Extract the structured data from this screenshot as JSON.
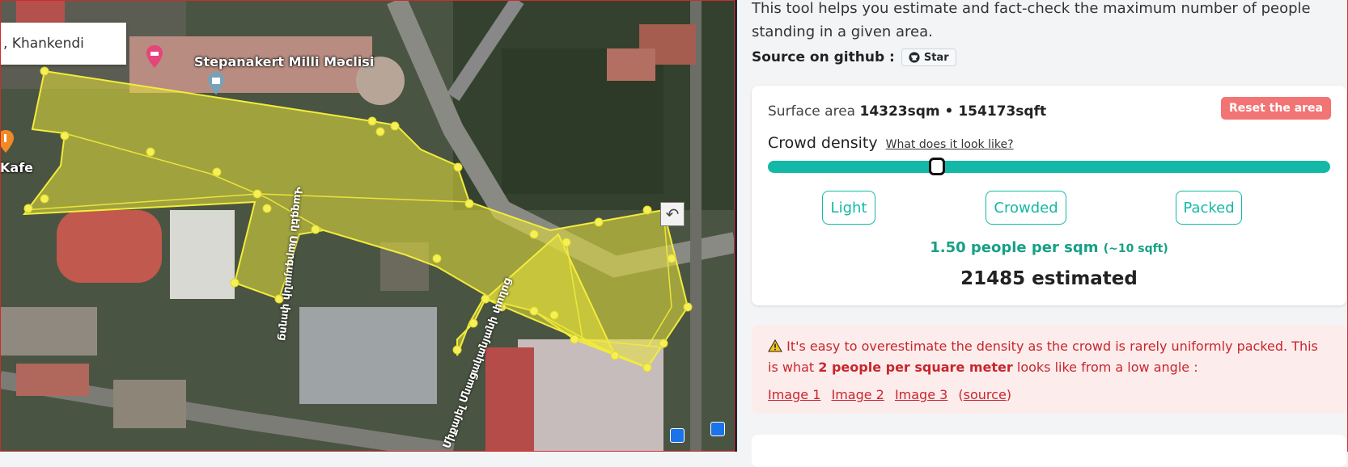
{
  "map": {
    "search_value": ", Khankendi",
    "places": [
      {
        "name": "Stepanakert Milli Məclisi"
      },
      {
        "name": "Kafe"
      }
    ],
    "streets": [
      "Կոմիտասի փողոց",
      "Վազգեն Սարգսյանի փողոց",
      "Միքայել Մնացականյանի փողոց"
    ],
    "undo_icon": "undo-icon",
    "polygon_color": "#e8e23a"
  },
  "panel": {
    "intro": "This tool helps you estimate and fact-check the maximum number of people standing in a given area.",
    "source_label": "Source on github :",
    "star_label": "Star",
    "surface_label": "Surface area",
    "surface_value": "14323sqm • 154173sqft",
    "reset_label": "Reset the area",
    "density_label": "Crowd density",
    "density_link": "What does it look like?",
    "slider_position": 0.3,
    "presets": [
      "Light",
      "Crowded",
      "Packed"
    ],
    "per_sqm": "1.50 people per sqm",
    "per_sqft": "(~10 sqft)",
    "estimated": "21485 estimated",
    "warning_text_1": "It's easy to overestimate the density as the crowd is rarely uniformly packed. This is what ",
    "warning_bold": "2 people per square meter",
    "warning_text_2": " looks like from a low angle :",
    "image_links": [
      "Image 1",
      "Image 2",
      "Image 3"
    ],
    "source_link": "source",
    "accent": "#14b8a6",
    "warning_color": "#c8262c"
  }
}
